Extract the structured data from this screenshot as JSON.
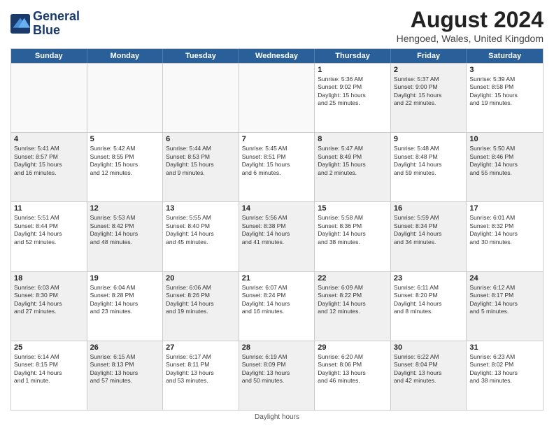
{
  "header": {
    "logo_line1": "General",
    "logo_line2": "Blue",
    "month_title": "August 2024",
    "location": "Hengoed, Wales, United Kingdom"
  },
  "days_of_week": [
    "Sunday",
    "Monday",
    "Tuesday",
    "Wednesday",
    "Thursday",
    "Friday",
    "Saturday"
  ],
  "footer": {
    "note": "Daylight hours"
  },
  "weeks": [
    [
      {
        "day": "",
        "info": "",
        "empty": true
      },
      {
        "day": "",
        "info": "",
        "empty": true
      },
      {
        "day": "",
        "info": "",
        "empty": true
      },
      {
        "day": "",
        "info": "",
        "empty": true
      },
      {
        "day": "1",
        "info": "Sunrise: 5:36 AM\nSunset: 9:02 PM\nDaylight: 15 hours\nand 25 minutes.",
        "shaded": false
      },
      {
        "day": "2",
        "info": "Sunrise: 5:37 AM\nSunset: 9:00 PM\nDaylight: 15 hours\nand 22 minutes.",
        "shaded": true
      },
      {
        "day": "3",
        "info": "Sunrise: 5:39 AM\nSunset: 8:58 PM\nDaylight: 15 hours\nand 19 minutes.",
        "shaded": false
      }
    ],
    [
      {
        "day": "4",
        "info": "Sunrise: 5:41 AM\nSunset: 8:57 PM\nDaylight: 15 hours\nand 16 minutes.",
        "shaded": true
      },
      {
        "day": "5",
        "info": "Sunrise: 5:42 AM\nSunset: 8:55 PM\nDaylight: 15 hours\nand 12 minutes.",
        "shaded": false
      },
      {
        "day": "6",
        "info": "Sunrise: 5:44 AM\nSunset: 8:53 PM\nDaylight: 15 hours\nand 9 minutes.",
        "shaded": true
      },
      {
        "day": "7",
        "info": "Sunrise: 5:45 AM\nSunset: 8:51 PM\nDaylight: 15 hours\nand 6 minutes.",
        "shaded": false
      },
      {
        "day": "8",
        "info": "Sunrise: 5:47 AM\nSunset: 8:49 PM\nDaylight: 15 hours\nand 2 minutes.",
        "shaded": true
      },
      {
        "day": "9",
        "info": "Sunrise: 5:48 AM\nSunset: 8:48 PM\nDaylight: 14 hours\nand 59 minutes.",
        "shaded": false
      },
      {
        "day": "10",
        "info": "Sunrise: 5:50 AM\nSunset: 8:46 PM\nDaylight: 14 hours\nand 55 minutes.",
        "shaded": true
      }
    ],
    [
      {
        "day": "11",
        "info": "Sunrise: 5:51 AM\nSunset: 8:44 PM\nDaylight: 14 hours\nand 52 minutes.",
        "shaded": false
      },
      {
        "day": "12",
        "info": "Sunrise: 5:53 AM\nSunset: 8:42 PM\nDaylight: 14 hours\nand 48 minutes.",
        "shaded": true
      },
      {
        "day": "13",
        "info": "Sunrise: 5:55 AM\nSunset: 8:40 PM\nDaylight: 14 hours\nand 45 minutes.",
        "shaded": false
      },
      {
        "day": "14",
        "info": "Sunrise: 5:56 AM\nSunset: 8:38 PM\nDaylight: 14 hours\nand 41 minutes.",
        "shaded": true
      },
      {
        "day": "15",
        "info": "Sunrise: 5:58 AM\nSunset: 8:36 PM\nDaylight: 14 hours\nand 38 minutes.",
        "shaded": false
      },
      {
        "day": "16",
        "info": "Sunrise: 5:59 AM\nSunset: 8:34 PM\nDaylight: 14 hours\nand 34 minutes.",
        "shaded": true
      },
      {
        "day": "17",
        "info": "Sunrise: 6:01 AM\nSunset: 8:32 PM\nDaylight: 14 hours\nand 30 minutes.",
        "shaded": false
      }
    ],
    [
      {
        "day": "18",
        "info": "Sunrise: 6:03 AM\nSunset: 8:30 PM\nDaylight: 14 hours\nand 27 minutes.",
        "shaded": true
      },
      {
        "day": "19",
        "info": "Sunrise: 6:04 AM\nSunset: 8:28 PM\nDaylight: 14 hours\nand 23 minutes.",
        "shaded": false
      },
      {
        "day": "20",
        "info": "Sunrise: 6:06 AM\nSunset: 8:26 PM\nDaylight: 14 hours\nand 19 minutes.",
        "shaded": true
      },
      {
        "day": "21",
        "info": "Sunrise: 6:07 AM\nSunset: 8:24 PM\nDaylight: 14 hours\nand 16 minutes.",
        "shaded": false
      },
      {
        "day": "22",
        "info": "Sunrise: 6:09 AM\nSunset: 8:22 PM\nDaylight: 14 hours\nand 12 minutes.",
        "shaded": true
      },
      {
        "day": "23",
        "info": "Sunrise: 6:11 AM\nSunset: 8:20 PM\nDaylight: 14 hours\nand 8 minutes.",
        "shaded": false
      },
      {
        "day": "24",
        "info": "Sunrise: 6:12 AM\nSunset: 8:17 PM\nDaylight: 14 hours\nand 5 minutes.",
        "shaded": true
      }
    ],
    [
      {
        "day": "25",
        "info": "Sunrise: 6:14 AM\nSunset: 8:15 PM\nDaylight: 14 hours\nand 1 minute.",
        "shaded": false
      },
      {
        "day": "26",
        "info": "Sunrise: 6:15 AM\nSunset: 8:13 PM\nDaylight: 13 hours\nand 57 minutes.",
        "shaded": true
      },
      {
        "day": "27",
        "info": "Sunrise: 6:17 AM\nSunset: 8:11 PM\nDaylight: 13 hours\nand 53 minutes.",
        "shaded": false
      },
      {
        "day": "28",
        "info": "Sunrise: 6:19 AM\nSunset: 8:09 PM\nDaylight: 13 hours\nand 50 minutes.",
        "shaded": true
      },
      {
        "day": "29",
        "info": "Sunrise: 6:20 AM\nSunset: 8:06 PM\nDaylight: 13 hours\nand 46 minutes.",
        "shaded": false
      },
      {
        "day": "30",
        "info": "Sunrise: 6:22 AM\nSunset: 8:04 PM\nDaylight: 13 hours\nand 42 minutes.",
        "shaded": true
      },
      {
        "day": "31",
        "info": "Sunrise: 6:23 AM\nSunset: 8:02 PM\nDaylight: 13 hours\nand 38 minutes.",
        "shaded": false
      }
    ]
  ]
}
